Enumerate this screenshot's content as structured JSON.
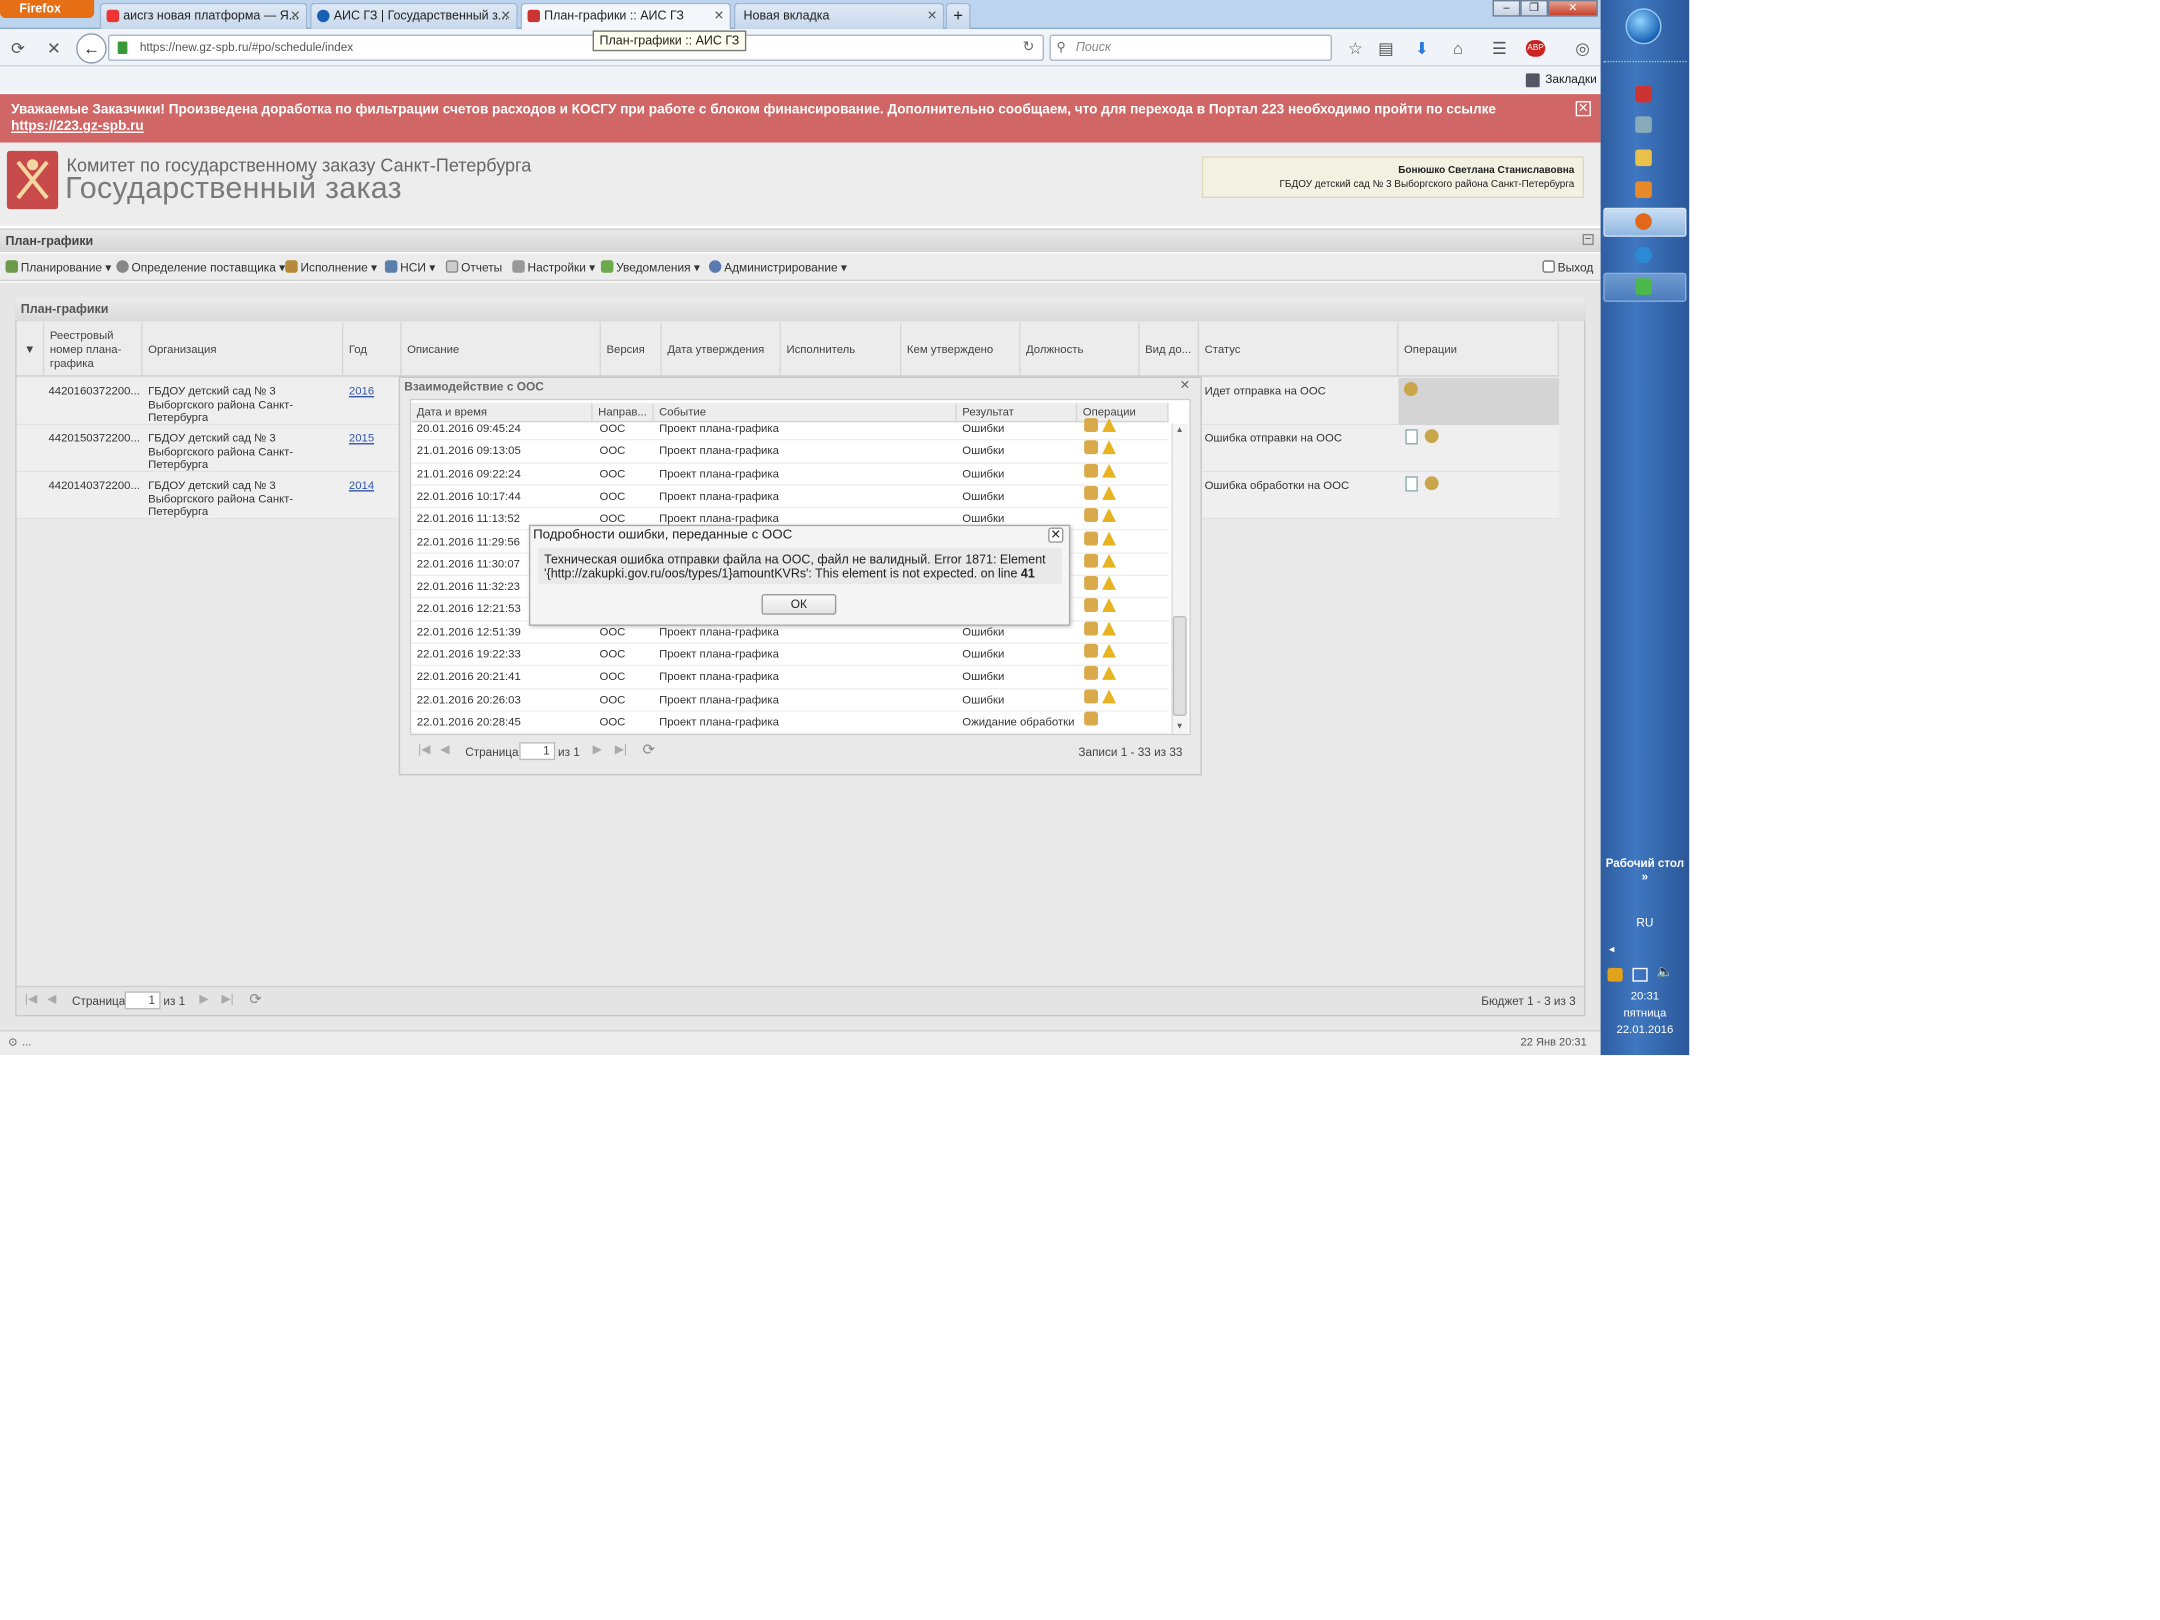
{
  "browser": {
    "app_button": "Firefox",
    "tabs": [
      {
        "label": "аисгз новая платформа — Я..."
      },
      {
        "label": "АИС ГЗ | Государственный з..."
      },
      {
        "label": "План-графики :: АИС ГЗ"
      },
      {
        "label": "Новая вкладка"
      }
    ],
    "new_tab": "+",
    "url": "https://new.gz-spb.ru/#po/schedule/index",
    "tooltip": "План-графики :: АИС ГЗ",
    "search_placeholder": "Поиск",
    "bookmarks_label": "Закладки"
  },
  "banner": {
    "text": "Уважаемые Заказчики! Произведена доработка по фильтрации счетов расходов и КОСГУ при работе с блоком финансирование. Дополнительно сообщаем, что для перехода в Портал 223 необходимо пройти по ссылке",
    "link": "https://223.gz-spb.ru"
  },
  "header": {
    "subtitle": "Комитет по государственному заказу Санкт-Петербурга",
    "title": "Государственный заказ",
    "user_name": "Бонюшко Светлана Станиславовна",
    "user_org": "ГБДОУ детский сад № 3 Выборгского района Санкт-Петербурга"
  },
  "panel": {
    "title": "План-графики"
  },
  "toolbar": {
    "items": [
      "Планирование",
      "Определение поставщика",
      "Исполнение",
      "НСИ",
      "Отчеты",
      "Настройки",
      "Уведомления",
      "Администрирование"
    ],
    "exit": "Выход"
  },
  "grid": {
    "title": "План-графики",
    "columns": [
      "Реестровый номер плана-графика",
      "Организация",
      "Год",
      "Описание",
      "Версия",
      "Дата утверждения",
      "Исполнитель",
      "Кем утверждено",
      "Должность",
      "Вид до...",
      "Статус",
      "Операции"
    ],
    "rows": [
      {
        "reg": "4420160372200...",
        "org": "ГБДОУ детский сад № 3 Выборгского района Санкт-Петербурга",
        "year": "2016",
        "status": "Идет отправка на ООС"
      },
      {
        "reg": "4420150372200...",
        "org": "ГБДОУ детский сад № 3 Выборгского района Санкт-Петербурга",
        "year": "2015",
        "status": "Ошибка отправки на ООС"
      },
      {
        "reg": "4420140372200...",
        "org": "ГБДОУ детский сад № 3 Выборгского района Санкт-Петербурга",
        "year": "2014",
        "status": "Ошибка обработки на ООС"
      }
    ],
    "page_label": "Страница",
    "page_value": "1",
    "page_of": "из 1",
    "summary": "Бюджет 1 - 3 из 3"
  },
  "oos": {
    "title": "Взаимодействие с ООС",
    "columns": [
      "Дата и время",
      "Направ...",
      "Событие",
      "Результат",
      "Операции"
    ],
    "rows": [
      {
        "dt": "20.01.2016 09:45:24",
        "dir": "ООС",
        "event": "Проект плана-графика",
        "result": "Ошибки"
      },
      {
        "dt": "21.01.2016 09:13:05",
        "dir": "ООС",
        "event": "Проект плана-графика",
        "result": "Ошибки"
      },
      {
        "dt": "21.01.2016 09:22:24",
        "dir": "ООС",
        "event": "Проект плана-графика",
        "result": "Ошибки"
      },
      {
        "dt": "22.01.2016 10:17:44",
        "dir": "ООС",
        "event": "Проект плана-графика",
        "result": "Ошибки"
      },
      {
        "dt": "22.01.2016 11:13:52",
        "dir": "ООС",
        "event": "Проект плана-графика",
        "result": "Ошибки"
      },
      {
        "dt": "22.01.2016 11:29:56",
        "dir": "",
        "event": "",
        "result": ""
      },
      {
        "dt": "22.01.2016 11:30:07",
        "dir": "",
        "event": "",
        "result": ""
      },
      {
        "dt": "22.01.2016 11:32:23",
        "dir": "",
        "event": "",
        "result": ""
      },
      {
        "dt": "22.01.2016 12:21:53",
        "dir": "",
        "event": "",
        "result": ""
      },
      {
        "dt": "22.01.2016 12:51:39",
        "dir": "ООС",
        "event": "Проект плана-графика",
        "result": "Ошибки"
      },
      {
        "dt": "22.01.2016 19:22:33",
        "dir": "ООС",
        "event": "Проект плана-графика",
        "result": "Ошибки"
      },
      {
        "dt": "22.01.2016 20:21:41",
        "dir": "ООС",
        "event": "Проект плана-графика",
        "result": "Ошибки"
      },
      {
        "dt": "22.01.2016 20:26:03",
        "dir": "ООС",
        "event": "Проект плана-графика",
        "result": "Ошибки"
      },
      {
        "dt": "22.01.2016 20:28:45",
        "dir": "ООС",
        "event": "Проект плана-графика",
        "result": "Ожидание обработки"
      }
    ],
    "page_label": "Страница",
    "page_value": "1",
    "page_of": "из 1",
    "summary": "Записи 1 - 33 из 33"
  },
  "error_dialog": {
    "title": "Подробности ошибки, переданные с ООС",
    "message_line1": "Техническая ошибка отправки файла на ООС, файл не валидный. Error 1871: Element",
    "message_line2": "'{http://zakupki.gov.ru/oos/types/1}amountKVRs': This element is not expected. on line",
    "message_bold": "41",
    "ok": "ОК"
  },
  "statusbar": {
    "left": "...",
    "right": "22 Янв 20:31"
  },
  "taskbar": {
    "desktop": "Рабочий стол",
    "lang": "RU",
    "time": "20:31",
    "day": "пятница",
    "date": "22.01.2016"
  },
  "colors": {
    "banner": "#d06666",
    "taskbar": "#3f77c0",
    "link": "#3355aa"
  }
}
